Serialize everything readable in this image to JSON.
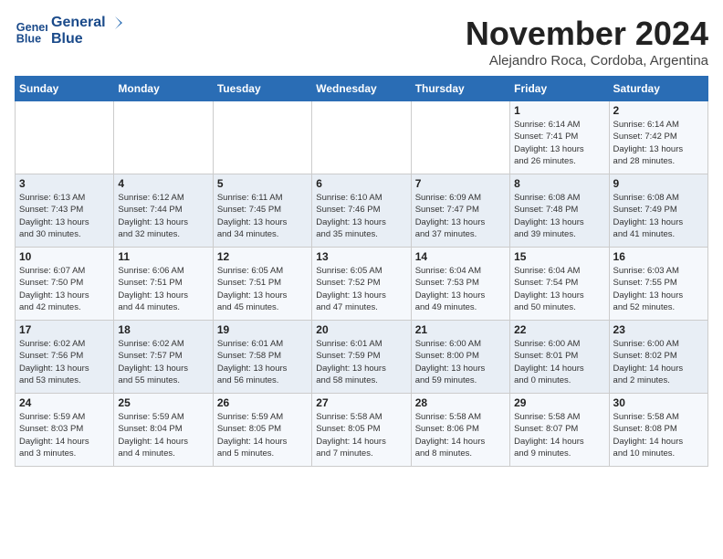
{
  "logo": {
    "line1": "General",
    "line2": "Blue"
  },
  "title": "November 2024",
  "location": "Alejandro Roca, Cordoba, Argentina",
  "weekdays": [
    "Sunday",
    "Monday",
    "Tuesday",
    "Wednesday",
    "Thursday",
    "Friday",
    "Saturday"
  ],
  "weeks": [
    [
      {
        "day": "",
        "info": ""
      },
      {
        "day": "",
        "info": ""
      },
      {
        "day": "",
        "info": ""
      },
      {
        "day": "",
        "info": ""
      },
      {
        "day": "",
        "info": ""
      },
      {
        "day": "1",
        "info": "Sunrise: 6:14 AM\nSunset: 7:41 PM\nDaylight: 13 hours\nand 26 minutes."
      },
      {
        "day": "2",
        "info": "Sunrise: 6:14 AM\nSunset: 7:42 PM\nDaylight: 13 hours\nand 28 minutes."
      }
    ],
    [
      {
        "day": "3",
        "info": "Sunrise: 6:13 AM\nSunset: 7:43 PM\nDaylight: 13 hours\nand 30 minutes."
      },
      {
        "day": "4",
        "info": "Sunrise: 6:12 AM\nSunset: 7:44 PM\nDaylight: 13 hours\nand 32 minutes."
      },
      {
        "day": "5",
        "info": "Sunrise: 6:11 AM\nSunset: 7:45 PM\nDaylight: 13 hours\nand 34 minutes."
      },
      {
        "day": "6",
        "info": "Sunrise: 6:10 AM\nSunset: 7:46 PM\nDaylight: 13 hours\nand 35 minutes."
      },
      {
        "day": "7",
        "info": "Sunrise: 6:09 AM\nSunset: 7:47 PM\nDaylight: 13 hours\nand 37 minutes."
      },
      {
        "day": "8",
        "info": "Sunrise: 6:08 AM\nSunset: 7:48 PM\nDaylight: 13 hours\nand 39 minutes."
      },
      {
        "day": "9",
        "info": "Sunrise: 6:08 AM\nSunset: 7:49 PM\nDaylight: 13 hours\nand 41 minutes."
      }
    ],
    [
      {
        "day": "10",
        "info": "Sunrise: 6:07 AM\nSunset: 7:50 PM\nDaylight: 13 hours\nand 42 minutes."
      },
      {
        "day": "11",
        "info": "Sunrise: 6:06 AM\nSunset: 7:51 PM\nDaylight: 13 hours\nand 44 minutes."
      },
      {
        "day": "12",
        "info": "Sunrise: 6:05 AM\nSunset: 7:51 PM\nDaylight: 13 hours\nand 45 minutes."
      },
      {
        "day": "13",
        "info": "Sunrise: 6:05 AM\nSunset: 7:52 PM\nDaylight: 13 hours\nand 47 minutes."
      },
      {
        "day": "14",
        "info": "Sunrise: 6:04 AM\nSunset: 7:53 PM\nDaylight: 13 hours\nand 49 minutes."
      },
      {
        "day": "15",
        "info": "Sunrise: 6:04 AM\nSunset: 7:54 PM\nDaylight: 13 hours\nand 50 minutes."
      },
      {
        "day": "16",
        "info": "Sunrise: 6:03 AM\nSunset: 7:55 PM\nDaylight: 13 hours\nand 52 minutes."
      }
    ],
    [
      {
        "day": "17",
        "info": "Sunrise: 6:02 AM\nSunset: 7:56 PM\nDaylight: 13 hours\nand 53 minutes."
      },
      {
        "day": "18",
        "info": "Sunrise: 6:02 AM\nSunset: 7:57 PM\nDaylight: 13 hours\nand 55 minutes."
      },
      {
        "day": "19",
        "info": "Sunrise: 6:01 AM\nSunset: 7:58 PM\nDaylight: 13 hours\nand 56 minutes."
      },
      {
        "day": "20",
        "info": "Sunrise: 6:01 AM\nSunset: 7:59 PM\nDaylight: 13 hours\nand 58 minutes."
      },
      {
        "day": "21",
        "info": "Sunrise: 6:00 AM\nSunset: 8:00 PM\nDaylight: 13 hours\nand 59 minutes."
      },
      {
        "day": "22",
        "info": "Sunrise: 6:00 AM\nSunset: 8:01 PM\nDaylight: 14 hours\nand 0 minutes."
      },
      {
        "day": "23",
        "info": "Sunrise: 6:00 AM\nSunset: 8:02 PM\nDaylight: 14 hours\nand 2 minutes."
      }
    ],
    [
      {
        "day": "24",
        "info": "Sunrise: 5:59 AM\nSunset: 8:03 PM\nDaylight: 14 hours\nand 3 minutes."
      },
      {
        "day": "25",
        "info": "Sunrise: 5:59 AM\nSunset: 8:04 PM\nDaylight: 14 hours\nand 4 minutes."
      },
      {
        "day": "26",
        "info": "Sunrise: 5:59 AM\nSunset: 8:05 PM\nDaylight: 14 hours\nand 5 minutes."
      },
      {
        "day": "27",
        "info": "Sunrise: 5:58 AM\nSunset: 8:05 PM\nDaylight: 14 hours\nand 7 minutes."
      },
      {
        "day": "28",
        "info": "Sunrise: 5:58 AM\nSunset: 8:06 PM\nDaylight: 14 hours\nand 8 minutes."
      },
      {
        "day": "29",
        "info": "Sunrise: 5:58 AM\nSunset: 8:07 PM\nDaylight: 14 hours\nand 9 minutes."
      },
      {
        "day": "30",
        "info": "Sunrise: 5:58 AM\nSunset: 8:08 PM\nDaylight: 14 hours\nand 10 minutes."
      }
    ]
  ]
}
